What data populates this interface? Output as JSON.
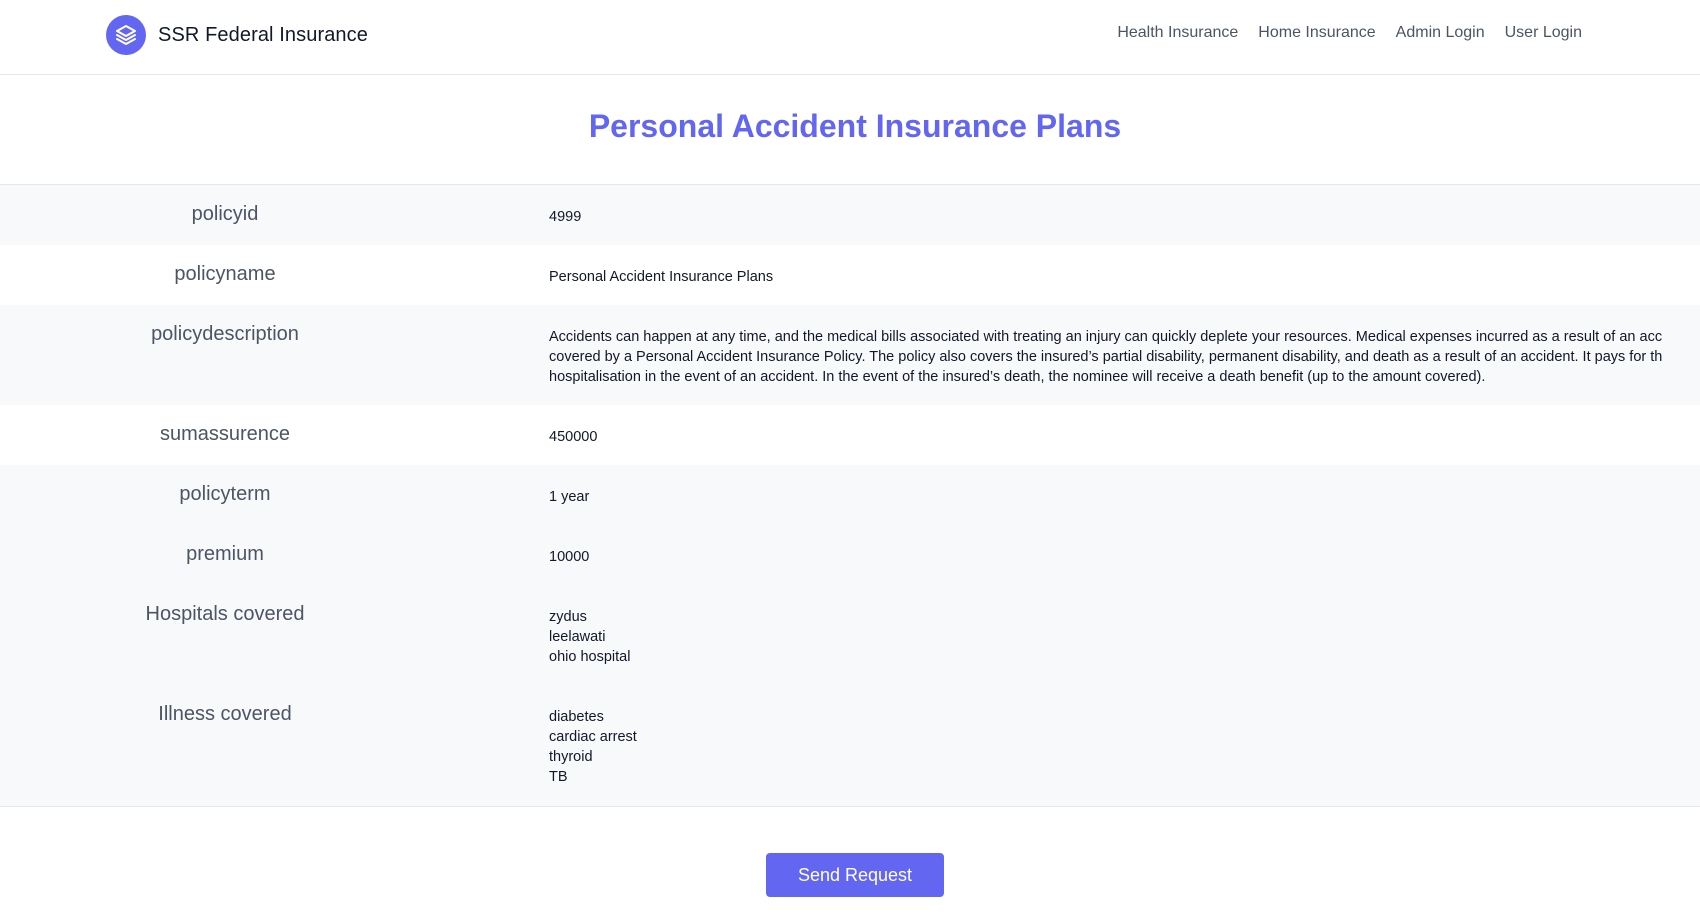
{
  "header": {
    "brand_name": "SSR Federal Insurance",
    "brand_icon": "layers-icon",
    "nav": [
      {
        "label": "Health Insurance"
      },
      {
        "label": "Home Insurance"
      },
      {
        "label": "Admin Login"
      },
      {
        "label": "User Login"
      }
    ]
  },
  "page_title": "Personal Accident Insurance Plans",
  "details": {
    "policyid": {
      "label": "policyid",
      "value": "4999"
    },
    "policyname": {
      "label": "policyname",
      "value": "Personal Accident Insurance Plans"
    },
    "policydescription": {
      "label": "policydescription",
      "lines": [
        "Accidents can happen at any time, and the medical bills associated with treating an injury can quickly deplete your resources. Medical expenses incurred as a result of an acc",
        "covered by a Personal Accident Insurance Policy. The policy also covers the insured’s partial disability, permanent disability, and death as a result of an accident. It pays for th",
        "hospitalisation in the event of an accident. In the event of the insured’s death, the nominee will receive a death benefit (up to the amount covered)."
      ]
    },
    "sumassurence": {
      "label": "sumassurence",
      "value": "450000"
    },
    "policyterm": {
      "label": "policyterm",
      "value": "1 year"
    },
    "premium": {
      "label": "premium",
      "value": "10000"
    },
    "hospitals": {
      "label": "Hospitals covered",
      "items": [
        "zydus",
        "leelawati",
        "ohio hospital"
      ]
    },
    "illness": {
      "label": "Illness covered",
      "items": [
        "diabetes",
        "cardiac arrest",
        "thyroid",
        "TB"
      ]
    }
  },
  "send_button": "Send Request",
  "colors": {
    "accent": "#6366f1",
    "row_shade": "#f8f9fb",
    "border": "#e5e7eb"
  }
}
